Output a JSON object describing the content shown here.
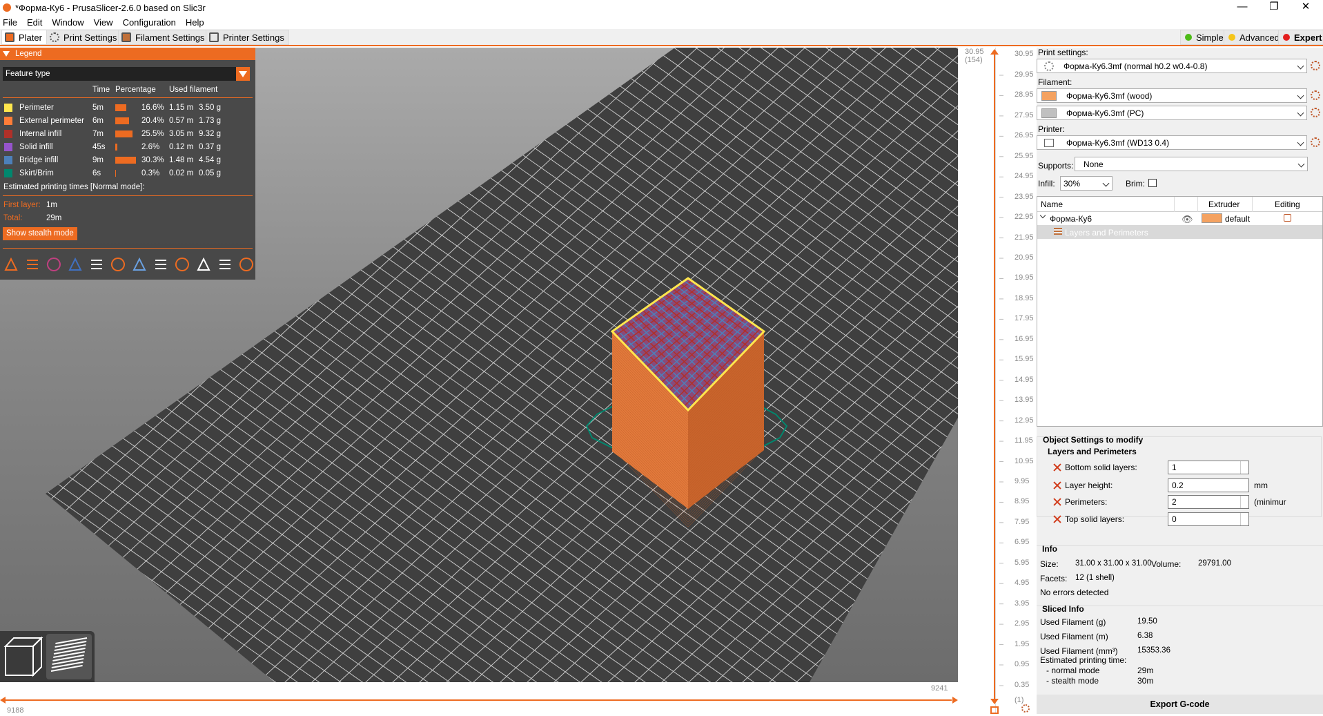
{
  "window": {
    "title": "*Форма-Ку6 - PrusaSlicer-2.6.0 based on Slic3r",
    "minimize": "—",
    "maximize": "❐",
    "close": "✕"
  },
  "menu": [
    "File",
    "Edit",
    "Window",
    "View",
    "Configuration",
    "Help"
  ],
  "tabs": [
    {
      "label": "Plater",
      "icon": "plater-icon"
    },
    {
      "label": "Print Settings",
      "icon": "gear-icon"
    },
    {
      "label": "Filament Settings",
      "icon": "spool-icon"
    },
    {
      "label": "Printer Settings",
      "icon": "printer-icon"
    }
  ],
  "modes": [
    {
      "label": "Simple",
      "color": "#4cbb17"
    },
    {
      "label": "Advanced",
      "color": "#f5c518"
    },
    {
      "label": "Expert",
      "color": "#e31e1e"
    }
  ],
  "legend": {
    "title": "Legend",
    "view_type": "Feature type",
    "headers": {
      "time": "Time",
      "percentage": "Percentage",
      "used": "Used filament"
    },
    "rows": [
      {
        "name": "Perimeter",
        "color": "#ffe64d",
        "time": "5m",
        "pct": "16.6%",
        "pct_value": 16.6,
        "length": "1.15 m",
        "weight": "3.50 g"
      },
      {
        "name": "External perimeter",
        "color": "#ff7d38",
        "time": "6m",
        "pct": "20.4%",
        "pct_value": 20.4,
        "length": "0.57 m",
        "weight": "1.73 g"
      },
      {
        "name": "Internal infill",
        "color": "#b03029",
        "time": "7m",
        "pct": "25.5%",
        "pct_value": 25.5,
        "length": "3.05 m",
        "weight": "9.32 g"
      },
      {
        "name": "Solid infill",
        "color": "#9654cc",
        "time": "45s",
        "pct": "2.6%",
        "pct_value": 2.6,
        "length": "0.12 m",
        "weight": "0.37 g"
      },
      {
        "name": "Bridge infill",
        "color": "#4d80ba",
        "time": "9m",
        "pct": "30.3%",
        "pct_value": 30.3,
        "length": "1.48 m",
        "weight": "4.54 g"
      },
      {
        "name": "Skirt/Brim",
        "color": "#00876e",
        "time": "6s",
        "pct": "0.3%",
        "pct_value": 0.3,
        "length": "0.02 m",
        "weight": "0.05 g"
      }
    ],
    "estimated_title": "Estimated printing times [Normal mode]:",
    "first_layer_label": "First layer:",
    "first_layer_value": "1m",
    "total_label": "Total:",
    "total_value": "29m",
    "stealth_button": "Show stealth mode"
  },
  "view_toolbar": [
    "travel-icon",
    "wipe-icon",
    "retractions-icon",
    "deretractions-icon",
    "seams-icon",
    "tool-changes-icon",
    "color-changes-icon",
    "pause-icon",
    "custom-gcode-icon",
    "center-of-gravity-icon",
    "shells-icon",
    "tool-marker-icon"
  ],
  "vertical_slider": {
    "top_value": "30.95",
    "top_layer": "(154)",
    "ticks": [
      "29.95",
      "28.95",
      "27.95",
      "26.95",
      "25.95",
      "24.95",
      "23.95",
      "22.95",
      "21.95",
      "20.95",
      "19.95",
      "18.95",
      "17.95",
      "16.95",
      "15.95",
      "14.95",
      "13.95",
      "12.95",
      "11.95",
      "10.95",
      "9.95",
      "8.95",
      "7.95",
      "6.95",
      "5.95",
      "4.95",
      "3.95",
      "2.95",
      "1.95",
      "0.95",
      "0.35"
    ],
    "bottom_layer": "(1)"
  },
  "horizontal_slider": {
    "left_value": "9188",
    "right_value": "9241"
  },
  "sidebar": {
    "print_settings_label": "Print settings:",
    "print_settings_value": "Форма-Ку6.3mf (normal h0.2 w0.4-0.8)",
    "filament_label": "Filament:",
    "filaments": [
      {
        "value": "Форма-Ку6.3mf (wood)",
        "color": "#f4a261"
      },
      {
        "value": "Форма-Ку6.3mf (PC)",
        "color": "#c0c0c0"
      }
    ],
    "printer_label": "Printer:",
    "printer_value": "Форма-Ку6.3mf (WD13 0.4)",
    "supports_label": "Supports:",
    "supports_value": "None",
    "infill_label": "Infill:",
    "infill_value": "30%",
    "brim_label": "Brim:",
    "object_list": {
      "headers": {
        "name": "Name",
        "extruder": "Extruder",
        "editing": "Editing"
      },
      "object_name": "Форма-Ку6",
      "extruder": "default",
      "extruder_color": "#f4a261",
      "sub_item": "Layers and Perimeters"
    },
    "object_settings": {
      "title": "Object Settings to modify",
      "subtitle": "Layers and Perimeters",
      "fields": [
        {
          "label": "Bottom solid layers:",
          "value": "1",
          "unit": ""
        },
        {
          "label": "Layer height:",
          "value": "0.2",
          "unit": "mm"
        },
        {
          "label": "Perimeters:",
          "value": "2",
          "unit": "(minimur"
        },
        {
          "label": "Top solid layers:",
          "value": "0",
          "unit": ""
        }
      ]
    },
    "info": {
      "title": "Info",
      "size_label": "Size:",
      "size_value": "31.00 x 31.00 x 31.00",
      "volume_label": "Volume:",
      "volume_value": "29791.00",
      "facets_label": "Facets:",
      "facets_value": "12 (1 shell)",
      "errors": "No errors detected"
    },
    "sliced_info": {
      "title": "Sliced Info",
      "rows": [
        {
          "label": "Used Filament (g)",
          "value": "19.50"
        },
        {
          "label": "Used Filament (m)",
          "value": "6.38"
        },
        {
          "label": "Used Filament (mm³)",
          "value": "15353.36"
        }
      ],
      "estimated_label": "Estimated printing time:",
      "normal_label": "- normal mode",
      "normal_value": "29m",
      "stealth_label": "- stealth mode",
      "stealth_value": "30m"
    },
    "export_button": "Export G-code"
  }
}
